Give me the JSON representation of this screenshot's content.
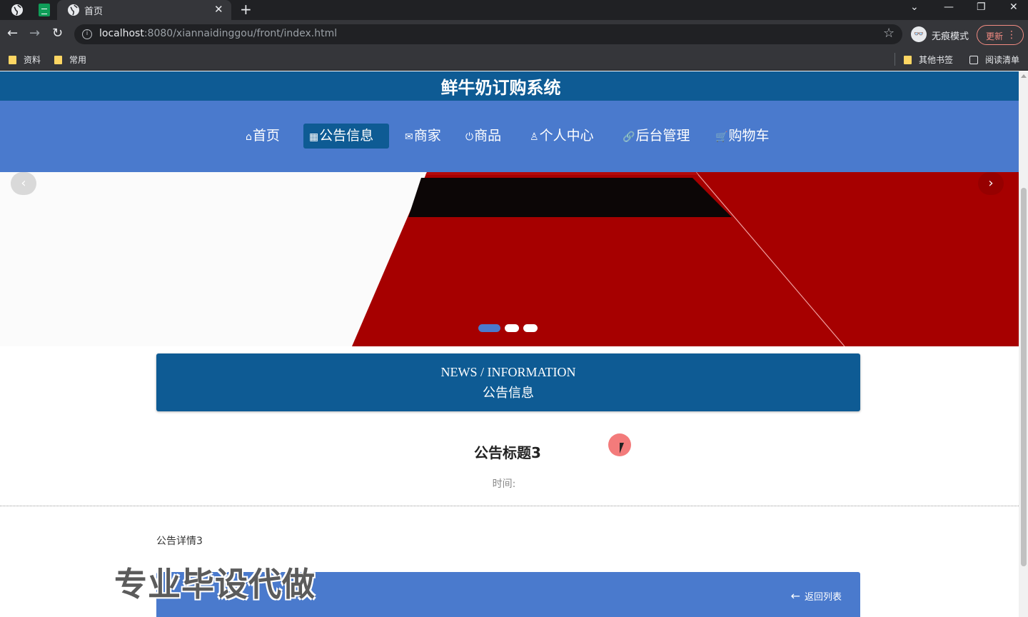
{
  "browser": {
    "tab_title": "首页",
    "url_host": "localhost",
    "url_path": ":8080/xiannaidinggou/front/index.html",
    "incognito_label": "无痕模式",
    "update_label": "更新",
    "bookmarks": [
      {
        "label": "资料"
      },
      {
        "label": "常用"
      },
      {
        "label": "其他书签"
      },
      {
        "label": "阅读清单"
      }
    ]
  },
  "site": {
    "title": "鲜牛奶订购系统",
    "nav": [
      {
        "label": "首页",
        "icon": "home-icon",
        "active": false
      },
      {
        "label": "公告信息",
        "icon": "gift-icon",
        "active": true
      },
      {
        "label": "商家",
        "icon": "mail-icon",
        "active": false
      },
      {
        "label": "商品",
        "icon": "power-icon",
        "active": false
      },
      {
        "label": "个人中心",
        "icon": "user-icon",
        "active": false
      },
      {
        "label": "后台管理",
        "icon": "link-icon",
        "active": false
      },
      {
        "label": "购物车",
        "icon": "cart-icon",
        "active": false
      }
    ],
    "carousel": {
      "slides": 3,
      "active_slide": 1
    }
  },
  "section": {
    "heading_en": "NEWS / INFORMATION",
    "heading_cn": "公告信息"
  },
  "article": {
    "title": "公告标题3",
    "time_label": "时间:",
    "body": "公告详情3",
    "back_label": "返回列表"
  },
  "overlay": {
    "watermark": "专业毕设代做"
  },
  "colors": {
    "header": "#0e5b94",
    "nav": "#4a7acd",
    "banner_red": "#a60000"
  }
}
